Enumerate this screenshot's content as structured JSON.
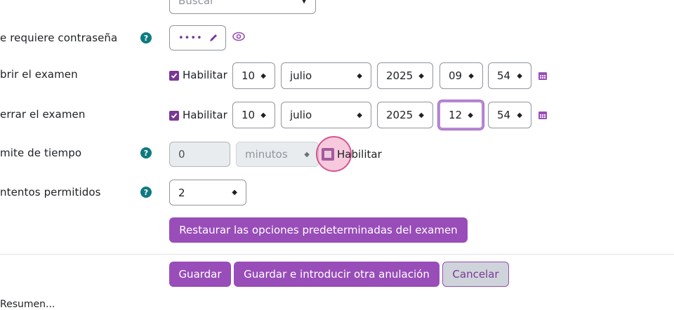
{
  "top_select": {
    "value": "Buscar"
  },
  "password_row": {
    "label": "e requiere contraseña",
    "value": "••••"
  },
  "open_row": {
    "label": "brir el examen",
    "enable_label": "Habilitar",
    "day": "10",
    "month": "julio",
    "year": "2025",
    "hour": "09",
    "minute": "54"
  },
  "close_row": {
    "label": "errar el examen",
    "enable_label": "Habilitar",
    "day": "10",
    "month": "julio",
    "year": "2025",
    "hour": "12",
    "minute": "54"
  },
  "time_limit_row": {
    "label": "mite de tiempo",
    "value": "0",
    "unit": "minutos",
    "enable_label": "Habilitar"
  },
  "attempts_row": {
    "label": "ntentos permitidos",
    "value": "2"
  },
  "restore_button": "Restaurar las opciones predeterminadas del examen",
  "footer": {
    "save": "Guardar",
    "save_and_add": "Guardar e introducir otra anulación",
    "cancel": "Cancelar"
  },
  "bottom_partial": "Resumen...",
  "colors": {
    "primary": "#984db8",
    "dark_primary": "#7a3796",
    "help": "#0e7a80"
  },
  "icons": [
    "help-icon",
    "pencil-icon",
    "eye-icon",
    "calendar-icon",
    "check-icon",
    "dropdown-arrow-icon"
  ]
}
